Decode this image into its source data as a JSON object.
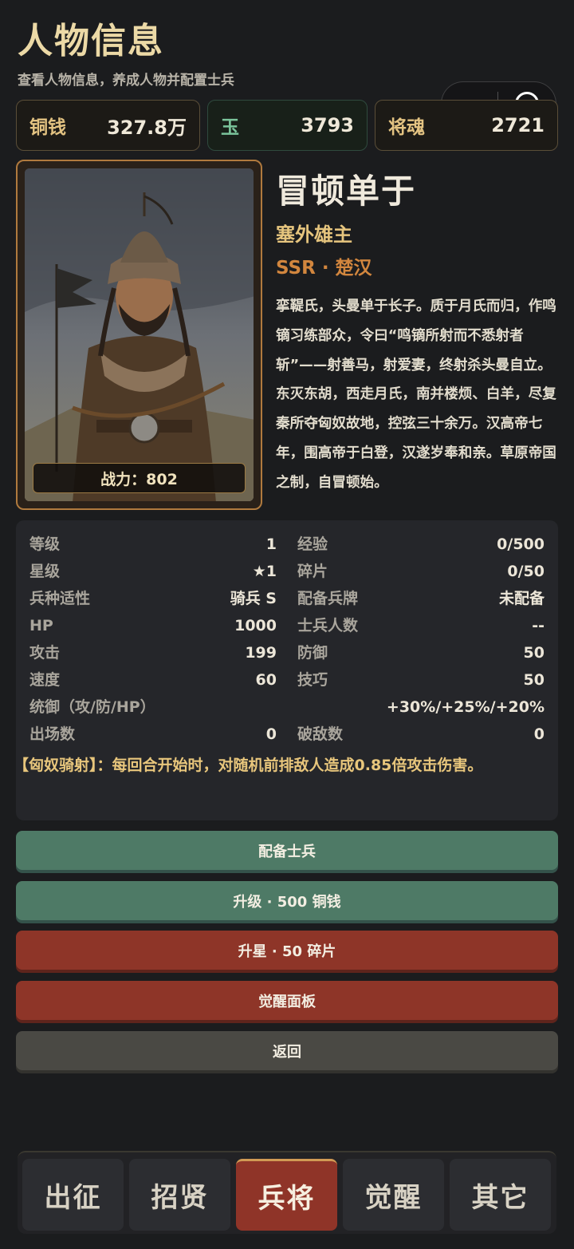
{
  "header": {
    "title": "人物信息",
    "subtitle": "查看人物信息，养成人物并配置士兵"
  },
  "currencies": {
    "copper_label": "铜钱",
    "copper_value": "327.8万",
    "jade_label": "玉",
    "jade_value": "3793",
    "soul_label": "将魂",
    "soul_value": "2721"
  },
  "hero": {
    "name": "冒顿单于",
    "title": "塞外雄主",
    "rarity_faction": "SSR · 楚汉",
    "power": "战力：802",
    "bio": "挛鞮氏，头曼单于长子。质于月氏而归，作鸣镝习练部众，令曰“鸣镝所射而不悉射者斩”——射善马，射爱妻，终射杀头曼自立。东灭东胡，西走月氏，南并楼烦、白羊，尽复秦所夺匈奴故地，控弦三十余万。汉高帝七年，围高帝于白登，汉遂岁奉和亲。草原帝国之制，自冒顿始。"
  },
  "stats": {
    "level_label": "等级",
    "level": "1",
    "exp_label": "经验",
    "exp": "0/500",
    "star_label": "星级",
    "star": "★1",
    "shard_label": "碎片",
    "shard": "0/50",
    "troop_fit_label": "兵种适性",
    "troop_fit": "骑兵 S",
    "equip_card_label": "配备兵牌",
    "equip_card": "未配备",
    "hp_label": "HP",
    "hp": "1000",
    "soldier_count_label": "士兵人数",
    "soldier_count": "--",
    "attack_label": "攻击",
    "attack": "199",
    "defense_label": "防御",
    "defense": "50",
    "speed_label": "速度",
    "speed": "60",
    "skill_label": "技巧",
    "skill": "50",
    "command_label": "统御（攻/防/HP）",
    "command": "+30%/+25%/+20%",
    "appearances_label": "出场数",
    "appearances": "0",
    "kills_label": "破敌数",
    "kills": "0"
  },
  "skill_text": "【匈奴骑射】：每回合开始时，对随机前排敌人造成0.85倍攻击伤害。",
  "actions": {
    "assign_soldiers": "配备士兵",
    "level_up": "升级 · 500 铜钱",
    "star_up": "升星 · 50 碎片",
    "awaken_panel": "觉醒面板",
    "back": "返回"
  },
  "tabs": [
    "出征",
    "招贤",
    "兵将",
    "觉醒",
    "其它"
  ],
  "active_tab": "兵将",
  "colors": {
    "accent_gold": "#e6c57e",
    "rarity_orange": "#d2863e",
    "green_button": "#4e7a66",
    "red_button": "#8e3528"
  }
}
